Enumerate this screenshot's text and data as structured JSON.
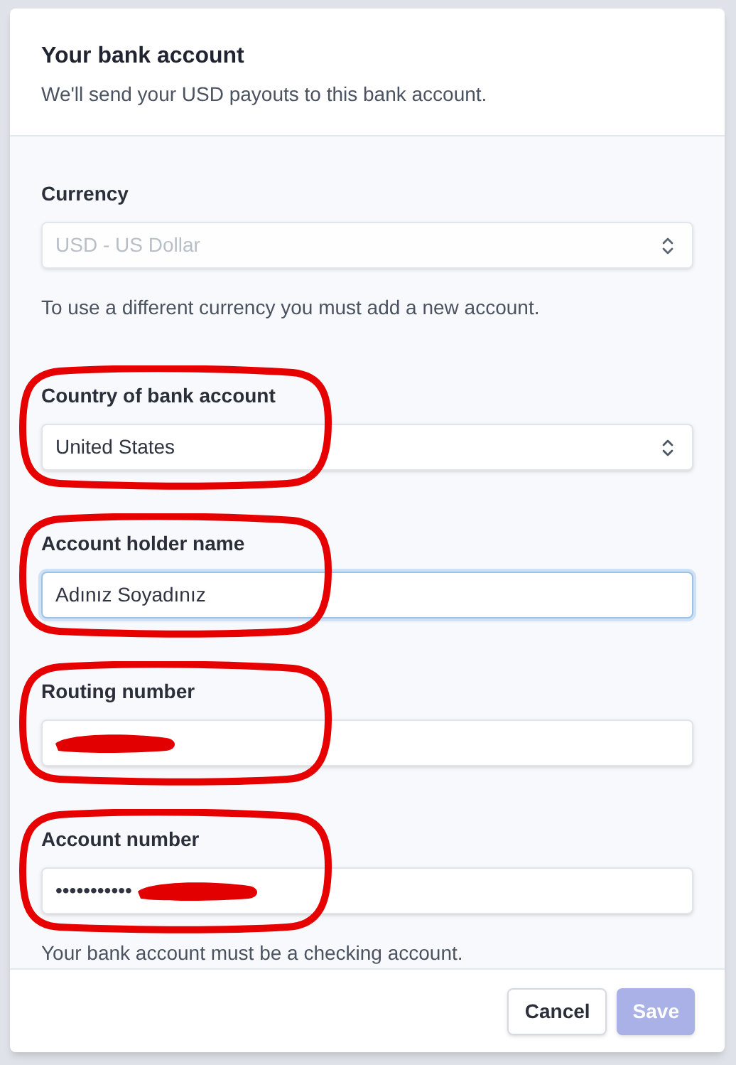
{
  "dialog": {
    "title": "Your bank account",
    "subtitle": "We'll send your USD payouts to this bank account."
  },
  "fields": [
    {
      "kind": "select",
      "label": "Currency",
      "value": "USD - US Dollar",
      "disabled": true,
      "focused": false,
      "annotated": false,
      "redacted": false,
      "help": "To use a different currency you must add a new account."
    },
    {
      "kind": "select",
      "label": "Country of bank account",
      "value": "United States",
      "disabled": false,
      "focused": false,
      "annotated": true,
      "redacted": false
    },
    {
      "kind": "input",
      "label": "Account holder name",
      "value": "Adınız Soyadınız",
      "disabled": false,
      "focused": true,
      "annotated": true,
      "redacted": false
    },
    {
      "kind": "input",
      "label": "Routing number",
      "disabled": false,
      "focused": false,
      "annotated": true,
      "redacted": true
    },
    {
      "kind": "input",
      "label": "Account number",
      "value": "•••••••••••",
      "disabled": false,
      "focused": false,
      "annotated": true,
      "redacted": true,
      "help": "Your bank account must be a checking account."
    }
  ],
  "buttons": [
    {
      "label": "Cancel",
      "kind": "secondary",
      "disabled": false
    },
    {
      "label": "Save",
      "kind": "primary",
      "disabled": true
    }
  ]
}
